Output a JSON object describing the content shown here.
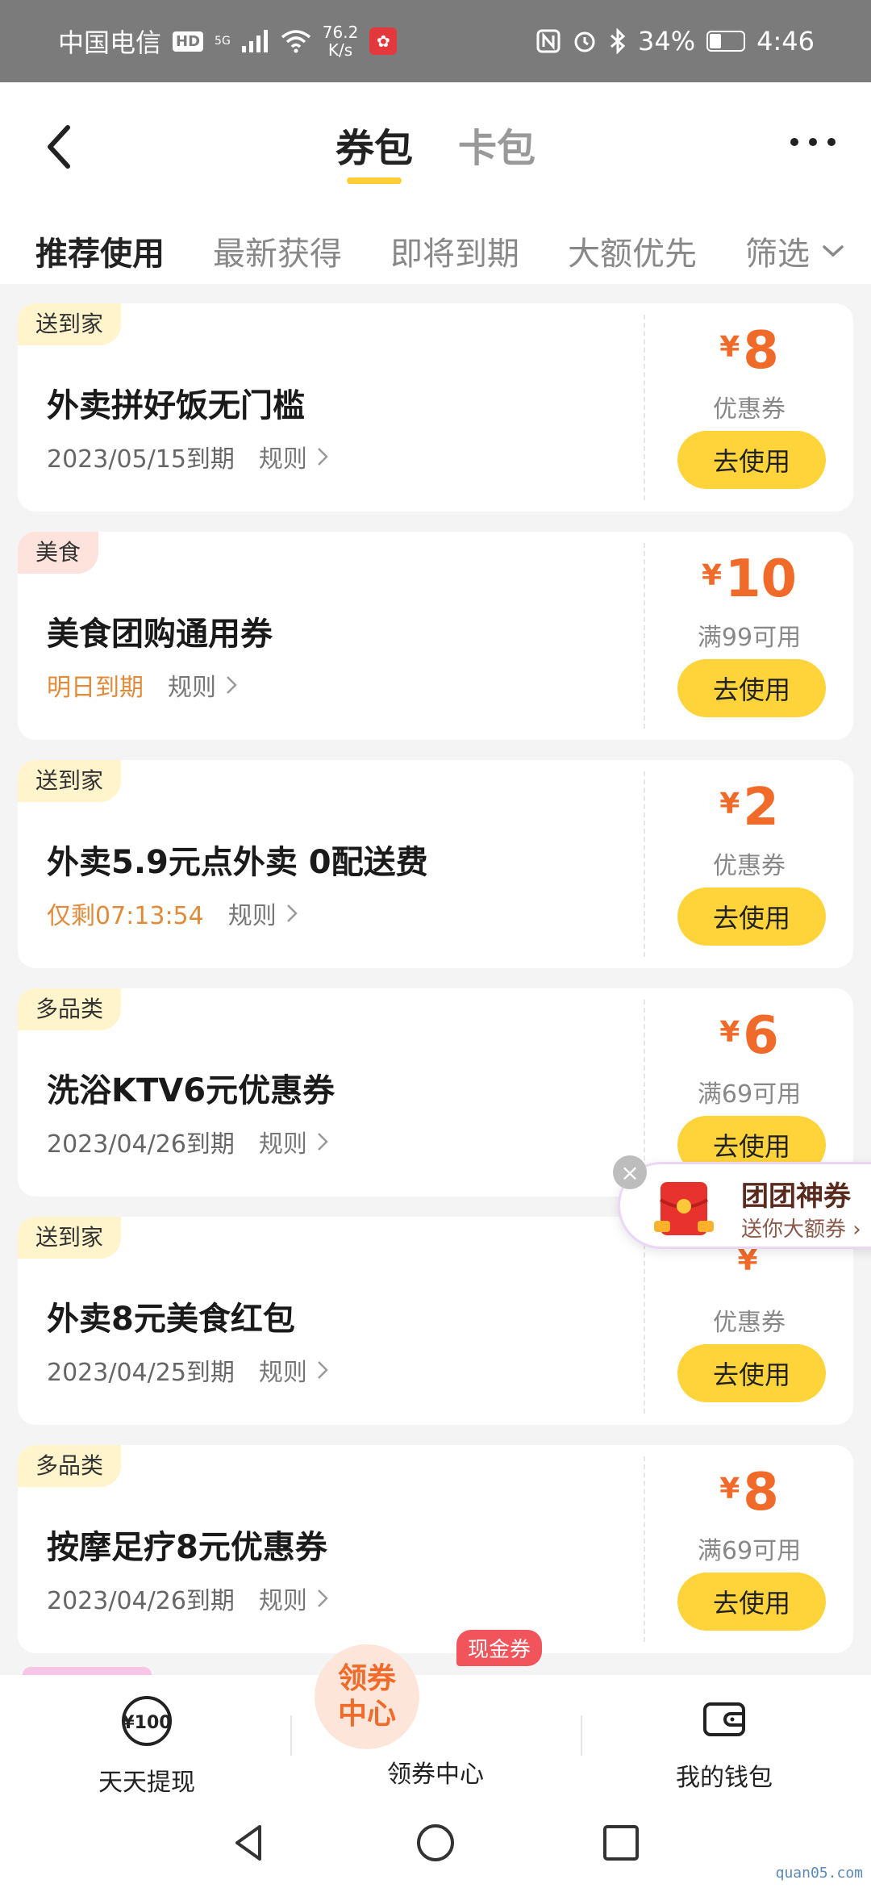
{
  "status_bar": {
    "carrier": "中国电信",
    "hd": "HD",
    "network": "5G",
    "speed_value": "76.2",
    "speed_unit": "K/s",
    "battery": "34%",
    "time": "4:46"
  },
  "header": {
    "tabs": [
      {
        "label": "券包",
        "active": true
      },
      {
        "label": "卡包",
        "active": false
      }
    ]
  },
  "filters": [
    {
      "label": "推荐使用",
      "active": true
    },
    {
      "label": "最新获得",
      "active": false
    },
    {
      "label": "即将到期",
      "active": false
    },
    {
      "label": "大额优先",
      "active": false
    }
  ],
  "filter_dropdown": "筛选",
  "coupons": [
    {
      "tag": "送到家",
      "title": "外卖拼好饭无门槛",
      "expire": "2023/05/15到期",
      "rule": "规则",
      "currency": "¥",
      "amount": "8",
      "desc": "优惠券",
      "button": "去使用"
    },
    {
      "tag": "美食",
      "title": "美食团购通用券",
      "expire": "明日到期",
      "rule": "规则",
      "currency": "¥",
      "amount": "10",
      "desc": "满99可用",
      "button": "去使用"
    },
    {
      "tag": "送到家",
      "title": "外卖5.9元点外卖 0配送费",
      "expire": "仅剩07:13:54",
      "rule": "规则",
      "currency": "¥",
      "amount": "2",
      "desc": "优惠券",
      "button": "去使用"
    },
    {
      "tag": "多品类",
      "title": "洗浴KTV6元优惠券",
      "expire": "2023/04/26到期",
      "rule": "规则",
      "currency": "¥",
      "amount": "6",
      "desc": "满69可用",
      "button": "去使用"
    },
    {
      "tag": "送到家",
      "title": "外卖8元美食红包",
      "expire": "2023/04/25到期",
      "rule": "规则",
      "currency": "¥",
      "amount": "",
      "desc": "优惠券",
      "button": "去使用"
    },
    {
      "tag": "多品类",
      "title": "按摩足疗8元优惠券",
      "expire": "2023/04/26到期",
      "rule": "规则",
      "currency": "¥",
      "amount": "8",
      "desc": "满69可用",
      "button": "去使用"
    }
  ],
  "promo": {
    "title": "团团神券",
    "subtitle": "送你大额券",
    "close": "×"
  },
  "bottom_nav": {
    "left_icon_text": "¥100",
    "left_label": "天天提现",
    "center_badge_line1": "领券",
    "center_badge_line2": "中心",
    "center_label": "领券中心",
    "cash_tag": "现金券",
    "right_label": "我的钱包"
  },
  "watermark": "quan05.com",
  "colors": {
    "accent_yellow": "#ffd43b",
    "price_orange": "#f06a2a",
    "warn_orange": "#e08a3a",
    "status_bar": "#7b7b7b"
  }
}
